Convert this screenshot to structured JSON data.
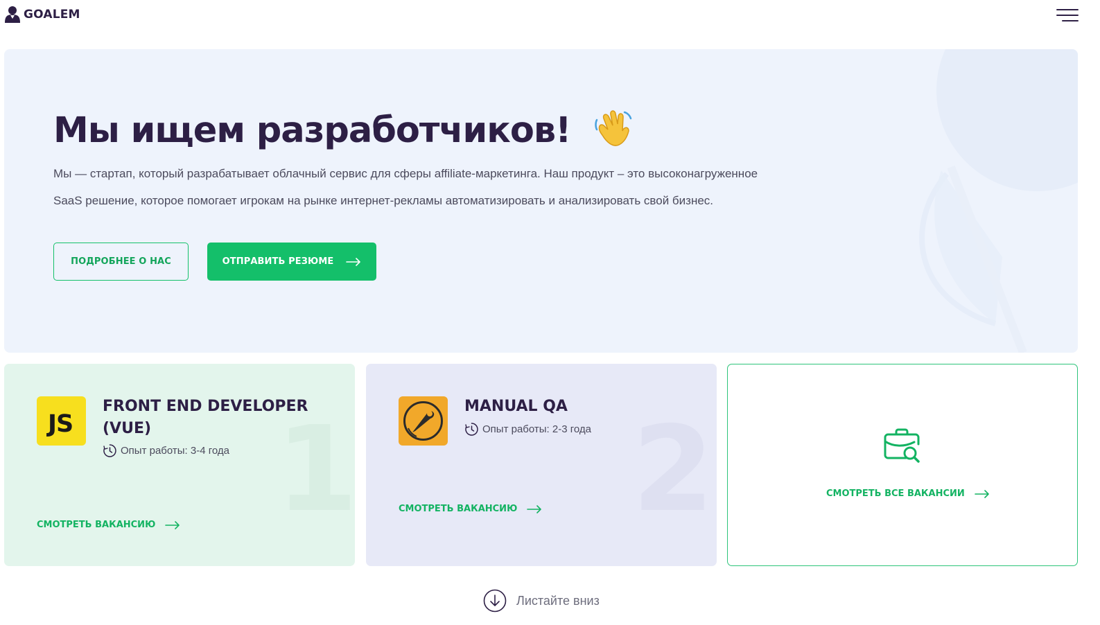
{
  "header": {
    "logo_text": "GOALEM",
    "logo_icon": "person-icon",
    "menu_icon": "hamburger-menu-icon"
  },
  "hero": {
    "title": "Мы ищем разработчиков!",
    "title_emoji": "waving-hand-icon",
    "description_line1": "Мы — стартап, который разрабатывает облачный сервис для сферы affiliate-маркетинга. Наш продукт – это высоконагруженное",
    "description_line2": "SaaS решение, которое помогает игрокам на рынке интернет-рекламы автоматизировать и анализировать свой бизнес.",
    "about_button_label": "ПОДРОБНЕЕ О НАС",
    "resume_button_label": "ОТПРАВИТЬ РЕЗЮМЕ"
  },
  "jobs": [
    {
      "number": "1",
      "logo_text": "JS",
      "logo_icon": "javascript-icon",
      "title": "FRONT END DEVELOPER (VUE)",
      "experience": "Опыт работы: 3-4 года",
      "link_label": "СМОТРЕТЬ ВАКАНСИЮ"
    },
    {
      "number": "2",
      "logo_icon": "postman-icon",
      "title": "MANUAL QA",
      "experience": "Опыт работы: 2-3 года",
      "link_label": "СМОТРЕТЬ ВАКАНСИЮ"
    }
  ],
  "all_jobs": {
    "icon": "briefcase-search-icon",
    "link_label": "СМОТРЕТЬ ВСЕ ВАКАНСИИ"
  },
  "scroll_hint": {
    "label": "Листайте вниз",
    "icon": "arrow-down-circle-icon"
  },
  "colors": {
    "brand_green": "#14bf6a",
    "dark_text": "#2d1f45",
    "hero_bg": "#eef3fc",
    "card1_bg": "#e3f5ec",
    "card2_bg": "#e7e9f7",
    "js_yellow": "#f7df1e",
    "postman_orange": "#f1a82a"
  }
}
